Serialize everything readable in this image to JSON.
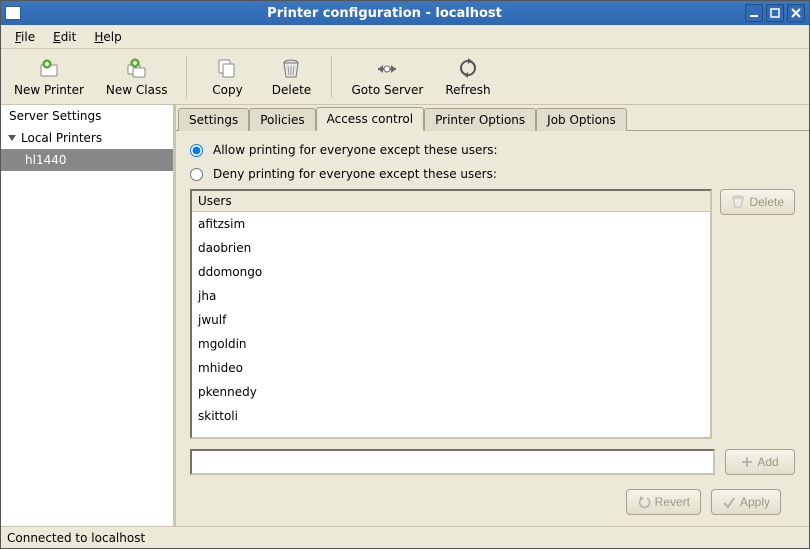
{
  "window": {
    "title": "Printer configuration - localhost"
  },
  "menubar": {
    "file": "File",
    "edit": "Edit",
    "help": "Help"
  },
  "toolbar": {
    "new_printer": "New Printer",
    "new_class": "New Class",
    "copy": "Copy",
    "delete": "Delete",
    "goto_server": "Goto Server",
    "refresh": "Refresh"
  },
  "sidebar": {
    "server_settings": "Server Settings",
    "local_printers": "Local Printers",
    "selected": "hl1440"
  },
  "tabs": {
    "settings": "Settings",
    "policies": "Policies",
    "access": "Access control",
    "printer_options": "Printer Options",
    "job_options": "Job Options"
  },
  "access": {
    "allow_label": "Allow printing for everyone except these users:",
    "deny_label": "Deny printing for everyone except these users:",
    "mode": "allow",
    "users_header": "Users",
    "users": [
      "afitzsim",
      "daobrien",
      "ddomongo",
      "jha",
      "jwulf",
      "mgoldin",
      "mhideo",
      "pkennedy",
      "skittoli"
    ],
    "new_user_value": ""
  },
  "buttons": {
    "delete": "Delete",
    "add": "Add",
    "revert": "Revert",
    "apply": "Apply"
  },
  "statusbar": "Connected to localhost"
}
